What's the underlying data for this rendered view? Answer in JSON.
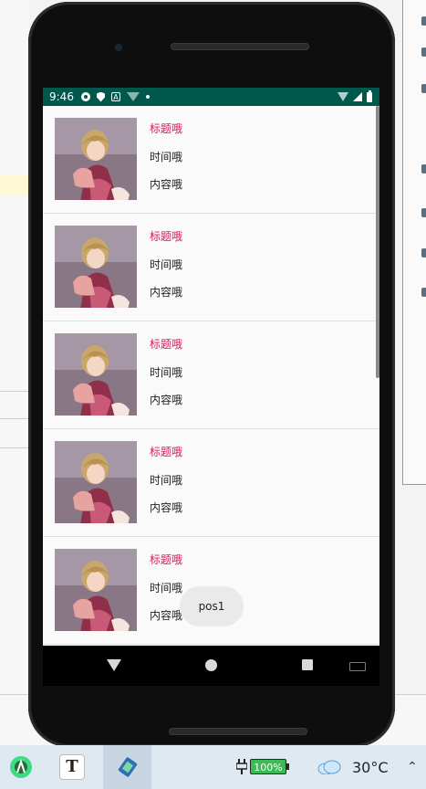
{
  "status_bar": {
    "time": "9:46",
    "a_badge": "A"
  },
  "list": {
    "items": [
      {
        "title": "标题哦",
        "time": "时间哦",
        "content": "内容哦"
      },
      {
        "title": "标题哦",
        "time": "时间哦",
        "content": "内容哦"
      },
      {
        "title": "标题哦",
        "time": "时间哦",
        "content": "内容哦"
      },
      {
        "title": "标题哦",
        "time": "时间哦",
        "content": "内容哦"
      },
      {
        "title": "标题哦",
        "time": "时间哦",
        "content": "内容哦"
      }
    ]
  },
  "toast": {
    "text": "pos1"
  },
  "taskbar": {
    "text_app_letter": "T",
    "battery_percent": "100%",
    "temperature": "30°C"
  },
  "colors": {
    "status_bar": "#00574b",
    "title_accent": "#d81b60",
    "battery_fill": "#3cba54"
  },
  "icons": {
    "status_left": [
      "settings-icon",
      "shield-icon",
      "a-badge-icon",
      "wifi-icon",
      "notification-dot-icon"
    ],
    "status_right": [
      "wifi-icon",
      "signal-icon",
      "battery-icon"
    ],
    "nav": [
      "back-icon",
      "home-icon",
      "recents-icon",
      "keyboard-icon"
    ],
    "taskbar": [
      "android-studio-icon",
      "text-app-icon",
      "emulator-icon",
      "power-plug-icon",
      "battery-icon",
      "weather-cloud-icon",
      "chevron-up-icon"
    ]
  }
}
